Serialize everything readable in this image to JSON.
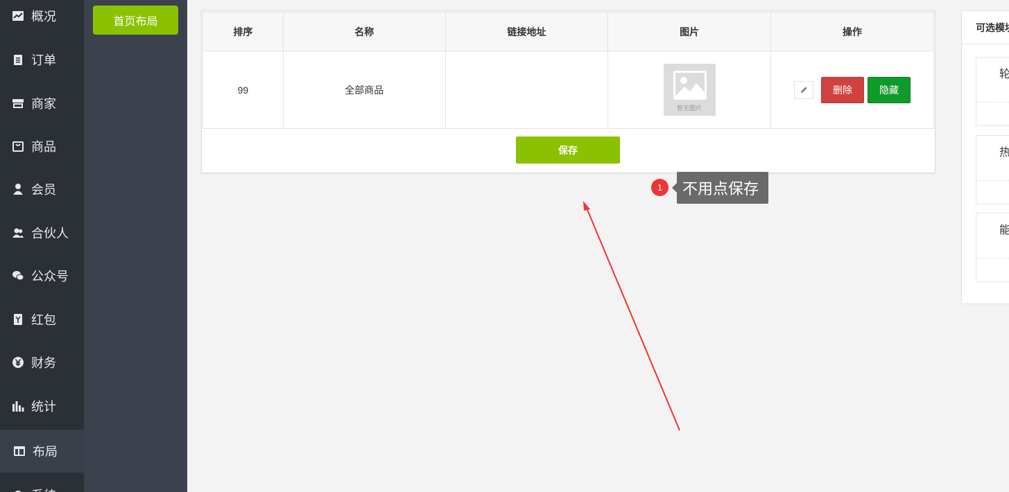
{
  "nav": {
    "items": [
      {
        "label": "概况",
        "icon": "chart-line-icon"
      },
      {
        "label": "订单",
        "icon": "clipboard-icon"
      },
      {
        "label": "商家",
        "icon": "store-icon"
      },
      {
        "label": "商品",
        "icon": "bag-icon"
      },
      {
        "label": "会员",
        "icon": "user-icon"
      },
      {
        "label": "合伙人",
        "icon": "users-icon"
      },
      {
        "label": "公众号",
        "icon": "wechat-icon"
      },
      {
        "label": "红包",
        "icon": "red-envelope-icon"
      },
      {
        "label": "财务",
        "icon": "yen-icon"
      },
      {
        "label": "统计",
        "icon": "bar-chart-icon"
      },
      {
        "label": "布局",
        "icon": "layout-icon"
      },
      {
        "label": "系统",
        "icon": "gear-icon"
      }
    ],
    "active": "布局"
  },
  "subnav": {
    "button_label": "首页布局"
  },
  "table": {
    "headers": [
      "排序",
      "名称",
      "链接地址",
      "图片",
      "操作"
    ],
    "rows": [
      {
        "sort": "99",
        "name": "全部商品",
        "link": "",
        "image_caption": "暂无图片"
      }
    ],
    "delete_label": "删除",
    "hide_label": "隐藏",
    "save_label": "保存"
  },
  "annotation": {
    "badge": "1",
    "text": "不用点保存"
  },
  "right_panel": {
    "title": "可选模块",
    "cards": [
      "轮",
      "热",
      "能"
    ]
  },
  "colors": {
    "accent_green": "#8bc200",
    "danger": "#d0423f",
    "success": "#0f9b2a",
    "nav_bg": "#2b2f36",
    "subnav_bg": "#3b414d"
  }
}
